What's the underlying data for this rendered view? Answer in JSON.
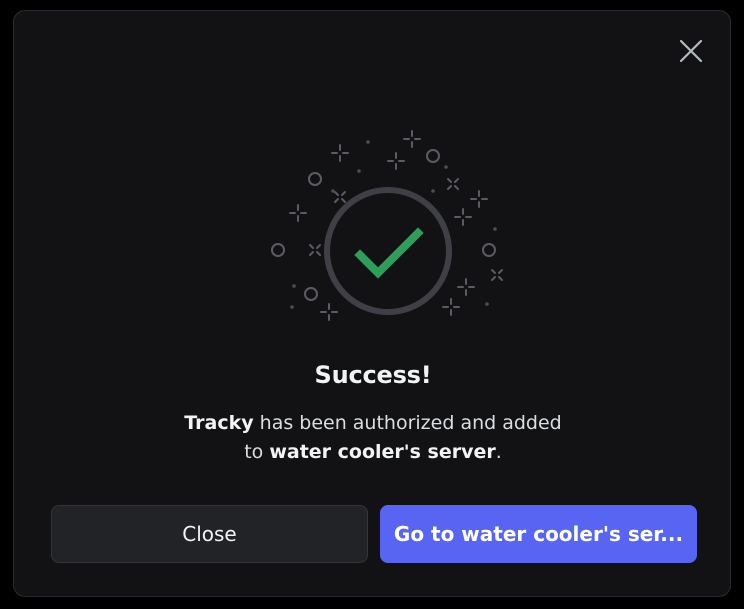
{
  "modal": {
    "title": "Success!",
    "description": {
      "app_name": "Tracky",
      "text_1": " has been authorized and added",
      "text_2": "to ",
      "server_name": "water cooler's server",
      "text_3": "."
    },
    "close_icon": "close-icon",
    "illustration_icon": "checkmark-icon"
  },
  "buttons": {
    "close_label": "Close",
    "go_label": "Go to water cooler's ser..."
  },
  "colors": {
    "background": "#121214",
    "accent": "#5865f2",
    "success": "#2f9e58",
    "ring": "#3f4046"
  }
}
